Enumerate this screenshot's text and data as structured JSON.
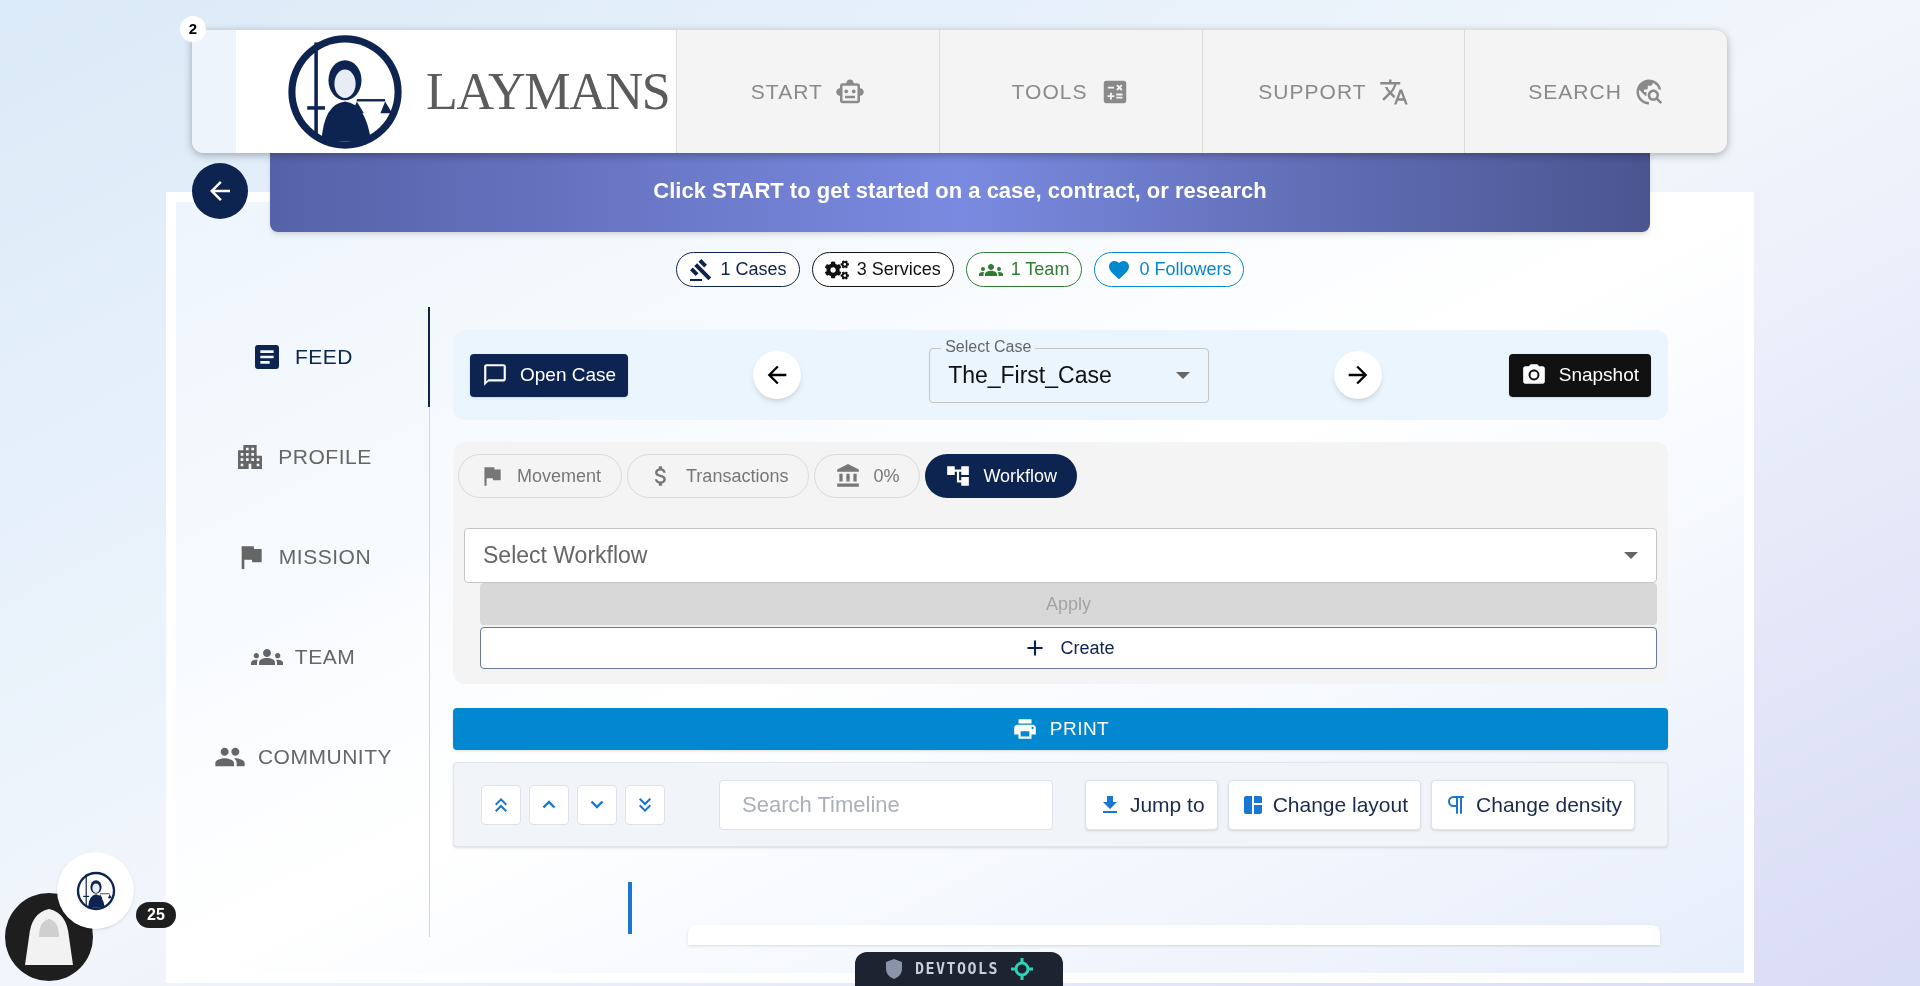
{
  "header": {
    "notification_count": "2",
    "brand": "LAYMANS",
    "nav": [
      {
        "label": "START",
        "kind": "ai"
      },
      {
        "label": "TOOLS",
        "kind": "tools"
      },
      {
        "label": "SUPPORT",
        "kind": "translate"
      },
      {
        "label": "SEARCH",
        "kind": "search"
      }
    ]
  },
  "banner": {
    "text": "Click START to get started on a case, contract, or research"
  },
  "stats": [
    {
      "label": "1 Cases",
      "kind": "cases",
      "color": "#0d2350"
    },
    {
      "label": "3 Services",
      "kind": "services",
      "color": "#111111"
    },
    {
      "label": "1 Team",
      "kind": "team",
      "color": "#2e7d32"
    },
    {
      "label": "0 Followers",
      "kind": "followers",
      "color": "#0288d1"
    }
  ],
  "sidebar": {
    "items": [
      {
        "label": "FEED",
        "kind": "feed",
        "selected": true
      },
      {
        "label": "PROFILE",
        "kind": "profile",
        "selected": false
      },
      {
        "label": "MISSION",
        "kind": "mission",
        "selected": false
      },
      {
        "label": "TEAM",
        "kind": "team",
        "selected": false
      },
      {
        "label": "COMMUNITY",
        "kind": "community",
        "selected": false
      }
    ]
  },
  "case_bar": {
    "open_button": "Open Case",
    "select": {
      "label": "Select Case",
      "value": "The_First_Case"
    },
    "snapshot_button": "Snapshot"
  },
  "tabs": [
    {
      "label": "Movement",
      "kind": "movement",
      "selected": false
    },
    {
      "label": "Transactions",
      "kind": "transactions",
      "selected": false
    },
    {
      "label": "0%",
      "kind": "bank",
      "selected": false
    },
    {
      "label": "Workflow",
      "kind": "workflow",
      "selected": true
    }
  ],
  "workflow": {
    "placeholder": "Select Workflow",
    "apply_button": {
      "label": "Apply",
      "disabled": true
    },
    "create_button": "Create"
  },
  "print_button": "PRINT",
  "timeline_toolbar": {
    "search_placeholder": "Search Timeline",
    "buttons": [
      {
        "label": "Jump to",
        "kind": "jump"
      },
      {
        "label": "Change layout",
        "kind": "layout"
      },
      {
        "label": "Change density",
        "kind": "density"
      }
    ]
  },
  "chat": {
    "unread": "25"
  },
  "devtools": {
    "label": "DEVTOOLS"
  }
}
